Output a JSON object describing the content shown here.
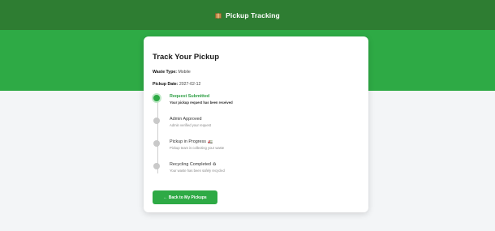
{
  "header": {
    "title": "Pickup Tracking",
    "icon": "package-icon"
  },
  "card": {
    "title": "Track Your Pickup",
    "waste_type_label": "Waste Type:",
    "waste_type_value": "Mobile",
    "pickup_date_label": "Pickup Date:",
    "pickup_date_value": "2027-02-12"
  },
  "steps": [
    {
      "title": "Request Submitted",
      "desc": "Your pickup request has been received",
      "status": "active"
    },
    {
      "title": "Admin Approved",
      "desc": "Admin verified your request",
      "status": "pending"
    },
    {
      "title": "Pickup in Progress",
      "emoji": "🚛",
      "desc": "Pickup team is collecting your waste",
      "status": "pending"
    },
    {
      "title": "Recycling Completed",
      "emoji": "♻",
      "desc": "Your waste has been safely recycled",
      "status": "pending"
    }
  ],
  "back_button": {
    "label": "← Back to My Pickups"
  },
  "colors": {
    "header": "#2e7d32",
    "hero": "#2eaa45",
    "accent": "#2eaa45"
  }
}
